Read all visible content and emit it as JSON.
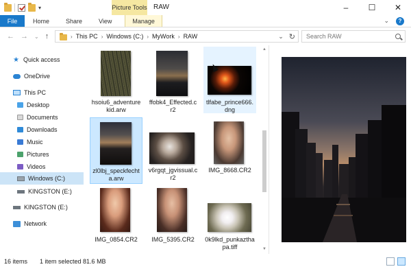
{
  "window": {
    "title": "RAW",
    "contextual_tab_group": "Picture Tools",
    "controls": {
      "minimize": "–",
      "maximize": "☐",
      "close": "✕"
    }
  },
  "quick_access_toolbar": {
    "dropdown": "▾"
  },
  "ribbon": {
    "tabs": [
      {
        "label": "File"
      },
      {
        "label": "Home"
      },
      {
        "label": "Share"
      },
      {
        "label": "View"
      },
      {
        "label": "Manage"
      }
    ],
    "expand_chevron": "⌄",
    "help": "?"
  },
  "navigation": {
    "back": "←",
    "forward": "→",
    "recent": "⌄",
    "up": "↑"
  },
  "address_bar": {
    "breadcrumbs": [
      "This PC",
      "Windows (C:)",
      "MyWork",
      "RAW"
    ],
    "separator": "›",
    "dropdown": "⌄",
    "refresh": "↻"
  },
  "search": {
    "placeholder": "Search RAW",
    "value": ""
  },
  "nav_pane": {
    "items": [
      {
        "label": "Quick access",
        "icon": "star-icon"
      },
      {
        "label": "OneDrive",
        "icon": "cloud-icon"
      },
      {
        "label": "This PC",
        "icon": "computer-icon"
      },
      {
        "label": "Desktop",
        "icon": "desktop-icon"
      },
      {
        "label": "Documents",
        "icon": "documents-icon"
      },
      {
        "label": "Downloads",
        "icon": "downloads-icon"
      },
      {
        "label": "Music",
        "icon": "music-icon"
      },
      {
        "label": "Pictures",
        "icon": "pictures-icon"
      },
      {
        "label": "Videos",
        "icon": "videos-icon"
      },
      {
        "label": "Windows (C:)",
        "icon": "drive-icon",
        "selected": true
      },
      {
        "label": "KINGSTON (E:)",
        "icon": "usb-drive-icon"
      },
      {
        "label": "KINGSTON (E:)",
        "icon": "usb-drive-icon"
      },
      {
        "label": "Network",
        "icon": "network-icon"
      }
    ]
  },
  "files": [
    {
      "name": "hsoiu6_adventurekid.arw",
      "line1": "hsoiu6_adventure",
      "line2": "kid.arw"
    },
    {
      "name": "ffobk4_Effected.cr2",
      "line1": "ffobk4_Effected.c",
      "line2": "r2"
    },
    {
      "name": "tlfabe_prince666.dng",
      "line1": "tlfabe_prince666.",
      "line2": "dng",
      "hovered": true
    },
    {
      "name": "zl0lbj_speckfechta.arw",
      "line1": "zl0lbj_speckfecht",
      "line2": "a.arw",
      "selected": true
    },
    {
      "name": "v6rgqt_jgvissual.cr2",
      "line1": "v6rgqt_jgvissual.c",
      "line2": "r2"
    },
    {
      "name": "IMG_8668.CR2",
      "line1": "IMG_8668.CR2",
      "line2": ""
    },
    {
      "name": "IMG_0854.CR2",
      "line1": "IMG_0854.CR2",
      "line2": ""
    },
    {
      "name": "IMG_5395.CR2",
      "line1": "IMG_5395.CR2",
      "line2": ""
    },
    {
      "name": "0k9lkd_punkazthapa.tiff",
      "line1": "0k9lkd_punkaztha",
      "line2": "pa.tiff"
    }
  ],
  "status": {
    "item_count": "16 items",
    "selection": "1 item selected  81.6 MB"
  },
  "colors": {
    "accent": "#1979ca",
    "selection": "#cce8ff",
    "picture_tools": "#f5e7a1"
  }
}
